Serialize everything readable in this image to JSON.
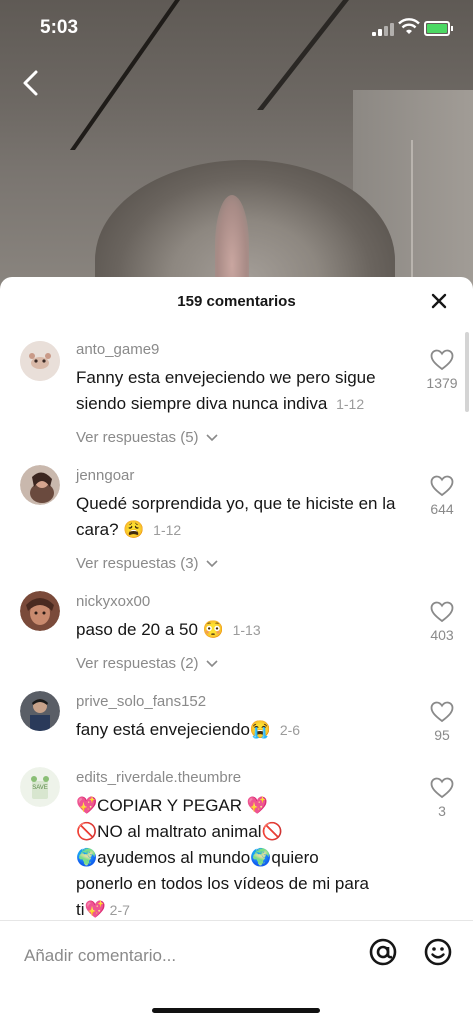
{
  "status_bar": {
    "time": "5:03"
  },
  "sheet": {
    "title": "159 comentarios"
  },
  "comments": [
    {
      "username": "anto_game9",
      "text": "Fanny esta envejeciendo we pero sigue siendo siempre diva nunca indiva",
      "date": "1-12",
      "replies": "Ver respuestas (5)",
      "likes": "1379"
    },
    {
      "username": "jenngoar",
      "text": "Quedé sorprendida yo, que te hiciste en la cara? 😩",
      "date": "1-12",
      "replies": "Ver respuestas (3)",
      "likes": "644"
    },
    {
      "username": "nickyxox00",
      "text": "paso de 20 a 50 😳",
      "date": "1-13",
      "replies": "Ver respuestas (2)",
      "likes": "403"
    },
    {
      "username": "prive_solo_fans152",
      "text": "fany está envejeciendo😭",
      "date": "2-6",
      "replies": "",
      "likes": "95"
    },
    {
      "username": "edits_riverdale.theumbre",
      "lines": [
        "💖COPIAR Y PEGAR 💖",
        "🚫NO al maltrato animal🚫",
        "🌍ayudemos al mundo🌍quiero",
        "ponerlo en todos los vídeos de mi para",
        "ti💖"
      ],
      "date": "2-7",
      "likes": "3"
    }
  ],
  "input": {
    "placeholder": "Añadir comentario..."
  },
  "colors": {
    "background": "#ffffff",
    "text": "#161616",
    "muted": "#8a8a8a"
  },
  "icons": [
    "back-arrow-icon",
    "close-icon",
    "heart-icon",
    "chevron-down-icon",
    "at-icon",
    "emoji-icon"
  ]
}
